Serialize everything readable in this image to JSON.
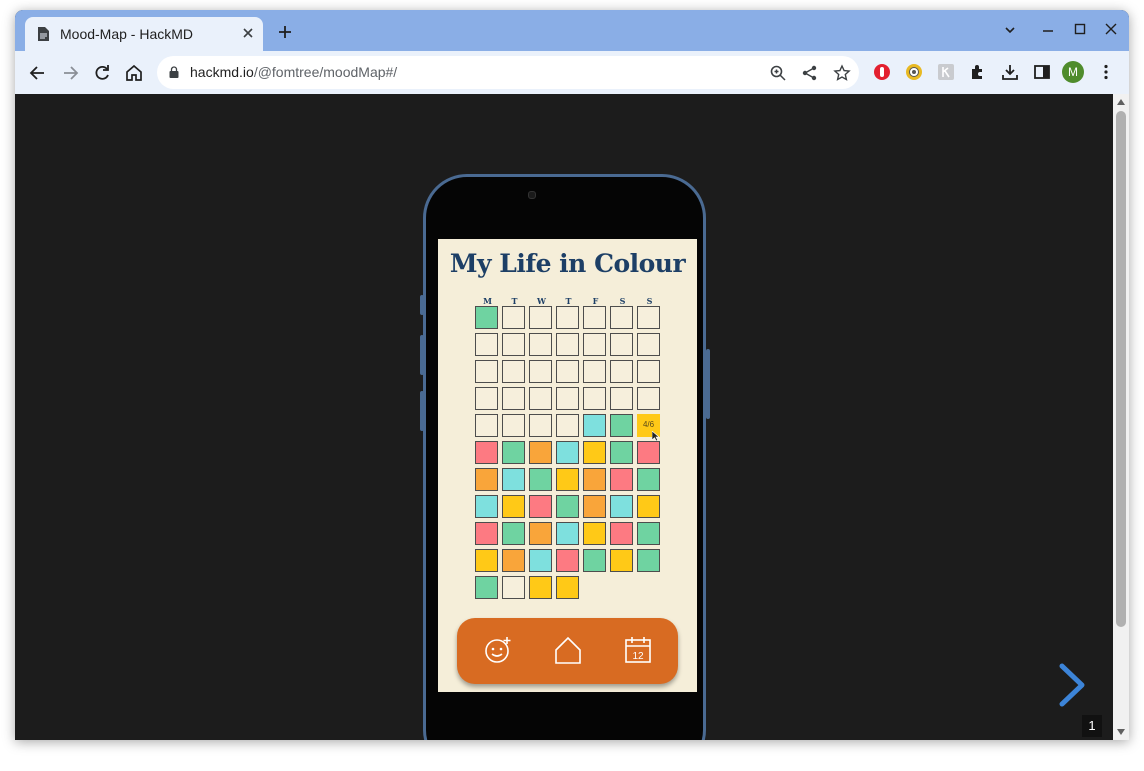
{
  "browser": {
    "tab_title": "Mood-Map - HackMD",
    "url_host": "hackmd.io",
    "url_path": "/@fomtree/moodMap#/",
    "profile_initial": "M",
    "accent_color": "#8aaee6"
  },
  "app": {
    "title": "My Life in Colour",
    "weekdays": [
      "M",
      "T",
      "W",
      "T",
      "F",
      "S",
      "S"
    ],
    "tooltip_label": "4/6",
    "mood_colors": {
      "green": "#6fd3a1",
      "cyan": "#7ee0de",
      "orange": "#f9a53a",
      "yellow": "#ffc917",
      "pink": "#fd7a82",
      "empty": "#f6efdc"
    },
    "mood_grid": [
      [
        "green",
        "empty",
        "empty",
        "empty",
        "empty",
        "empty",
        "empty"
      ],
      [
        "empty",
        "empty",
        "empty",
        "empty",
        "empty",
        "empty",
        "empty"
      ],
      [
        "empty",
        "empty",
        "empty",
        "empty",
        "empty",
        "empty",
        "empty"
      ],
      [
        "empty",
        "empty",
        "empty",
        "empty",
        "empty",
        "empty",
        "empty"
      ],
      [
        "empty",
        "empty",
        "empty",
        "empty",
        "cyan",
        "green",
        "yellow"
      ],
      [
        "pink",
        "green",
        "orange",
        "cyan",
        "yellow",
        "green",
        "pink"
      ],
      [
        "orange",
        "cyan",
        "green",
        "yellow",
        "orange",
        "pink",
        "green"
      ],
      [
        "cyan",
        "yellow",
        "pink",
        "green",
        "orange",
        "cyan",
        "yellow"
      ],
      [
        "pink",
        "green",
        "orange",
        "cyan",
        "yellow",
        "pink",
        "green"
      ],
      [
        "yellow",
        "orange",
        "cyan",
        "pink",
        "green",
        "yellow",
        "green"
      ],
      [
        "green",
        "empty",
        "yellow",
        "yellow"
      ]
    ],
    "nav_icons": [
      "add-mood-icon",
      "home-icon",
      "calendar-icon"
    ],
    "calendar_icon_text": "12",
    "nav_color": "#d86b22"
  },
  "slide": {
    "page_number": "1"
  }
}
